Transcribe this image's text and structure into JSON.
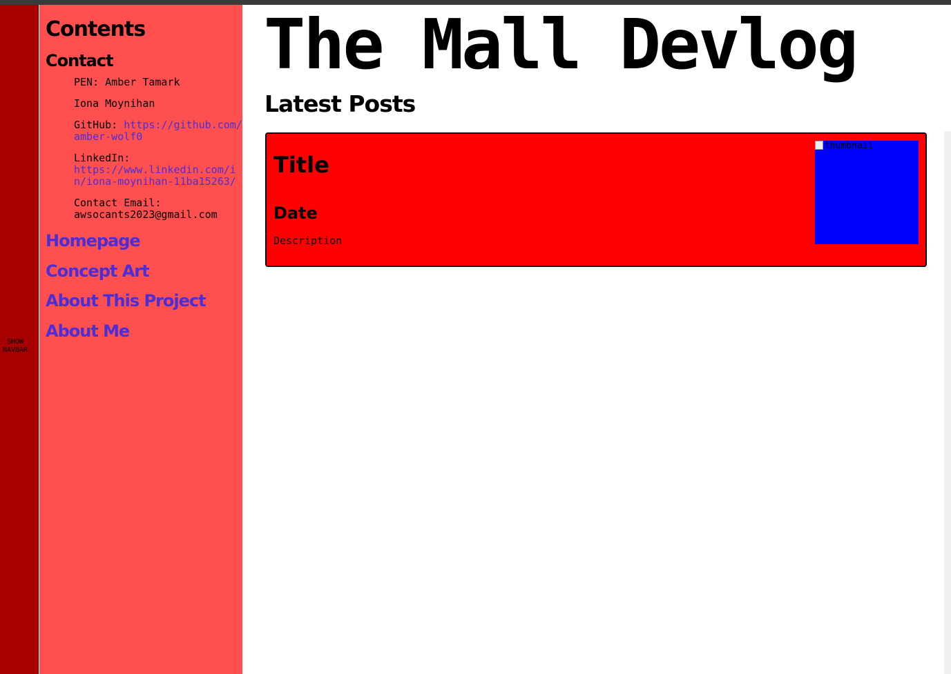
{
  "toggle": {
    "label": "SHOW\nNAVBAR"
  },
  "sidebar": {
    "heading": "Contents",
    "contact_heading": "Contact",
    "contact": {
      "pen_text": "PEN: Amber Tamark",
      "name": "Iona Moynihan",
      "github_label": "GitHub: ",
      "github_url": "https://github.com/amber-wolf0",
      "linkedin_label": "LinkedIn: ",
      "linkedin_url": "https://www.linkedin.com/in/iona-moynihan-11ba15263/",
      "email_label": "Contact Email: ",
      "email": "awsocants2023@gmail.com"
    },
    "nav": [
      {
        "label": "Homepage"
      },
      {
        "label": "Concept Art"
      },
      {
        "label": "About This Project"
      },
      {
        "label": "About Me"
      }
    ]
  },
  "main": {
    "site_title": "The Mall Devlog",
    "section_title": "Latest Posts",
    "post": {
      "title": "Title",
      "date": "Date",
      "description": "Description",
      "thumbnail_alt": "thumbnail"
    }
  },
  "colors": {
    "toggle_strip": "#a80000",
    "sidebar_bg": "#ff4f4f",
    "link": "#4a2ed6",
    "card_bg": "#ff0000",
    "thumbnail_bg": "#0000ff"
  }
}
